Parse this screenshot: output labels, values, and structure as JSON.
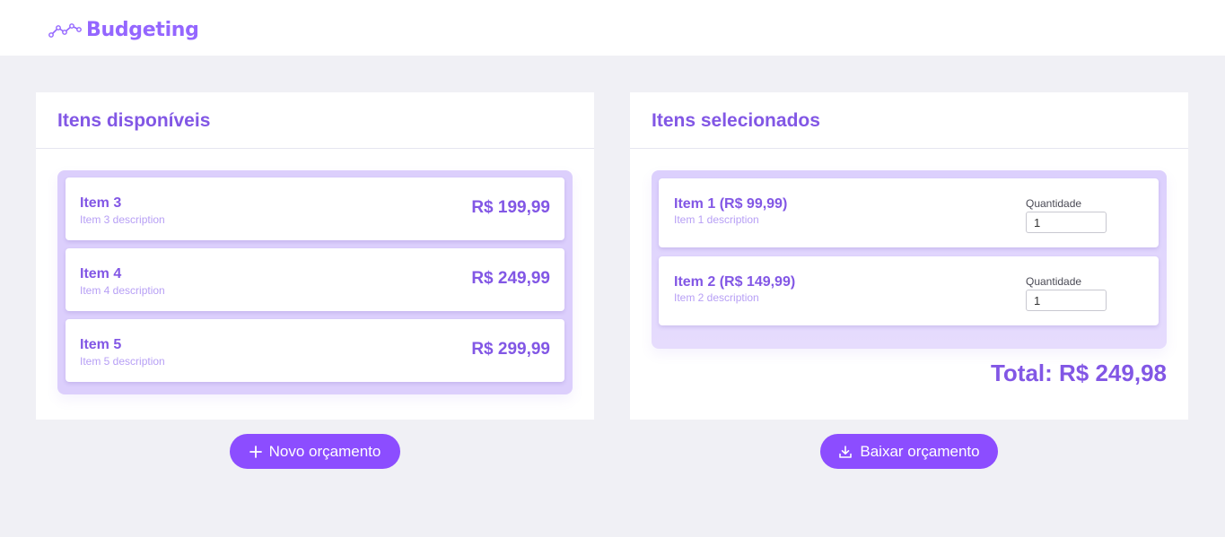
{
  "header": {
    "logo_text": "Budgeting",
    "logo_icon": "trend-line-icon"
  },
  "colors": {
    "primary": "#8257e5",
    "button": "#8c4dff",
    "description": "#b79ff5",
    "background": "#f0f0f5",
    "list_background": "#dccffc"
  },
  "available": {
    "title": "Itens disponíveis",
    "items": [
      {
        "name": "Item 3",
        "description": "Item 3 description",
        "price": "R$ 199,99"
      },
      {
        "name": "Item 4",
        "description": "Item 4 description",
        "price": "R$ 249,99"
      },
      {
        "name": "Item 5",
        "description": "Item 5 description",
        "price": "R$ 299,99"
      }
    ],
    "button_label": "Novo orçamento",
    "button_icon": "plus-icon"
  },
  "selected": {
    "title": "Itens selecionados",
    "items": [
      {
        "name": "Item 1 (R$ 99,99)",
        "description": "Item 1 description",
        "quantity_label": "Quantidade",
        "quantity": "1"
      },
      {
        "name": "Item 2 (R$ 149,99)",
        "description": "Item 2 description",
        "quantity_label": "Quantidade",
        "quantity": "1"
      }
    ],
    "total": "Total: R$ 249,98",
    "button_label": "Baixar orçamento",
    "button_icon": "download-icon"
  }
}
